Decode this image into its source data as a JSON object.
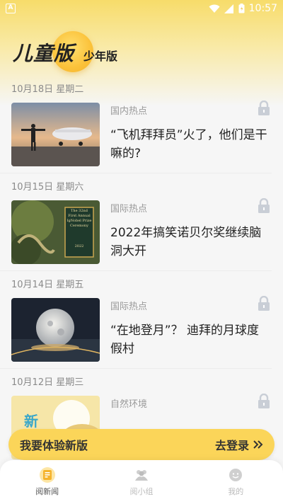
{
  "status_bar": {
    "left_badge": "A",
    "time": "10:57"
  },
  "header": {
    "logo_main": "儿童版",
    "logo_sub": "少年版"
  },
  "feed": [
    {
      "date": "10月18日 星期二",
      "category": "国内热点",
      "title": "“飞机拜拜员”火了，他们是干嘛的?"
    },
    {
      "date": "10月15日 星期六",
      "category": "国际热点",
      "title": "2022年搞笑诺贝尔奖继续脑洞大开"
    },
    {
      "date": "10月14日 星期五",
      "category": "国际热点",
      "title": "“在地登月”？ 迪拜的月球度假村"
    },
    {
      "date": "10月12日 星期三",
      "category": "自然环境",
      "title": ""
    }
  ],
  "thumb_texts": {
    "book_lines": [
      "The 32nd",
      "First Annual",
      "IgNobel Prize",
      "Ceremony",
      "2022"
    ],
    "new_badge": "新"
  },
  "banner": {
    "left": "我要体验新版",
    "right": "去登录"
  },
  "tabs": [
    {
      "label": "阅新闻",
      "icon": "news-icon",
      "active": true
    },
    {
      "label": "阅小组",
      "icon": "group-icon",
      "active": false
    },
    {
      "label": "我的",
      "icon": "profile-icon",
      "active": false
    }
  ],
  "colors": {
    "accent": "#fbd559",
    "lock": "#c9ced6"
  }
}
